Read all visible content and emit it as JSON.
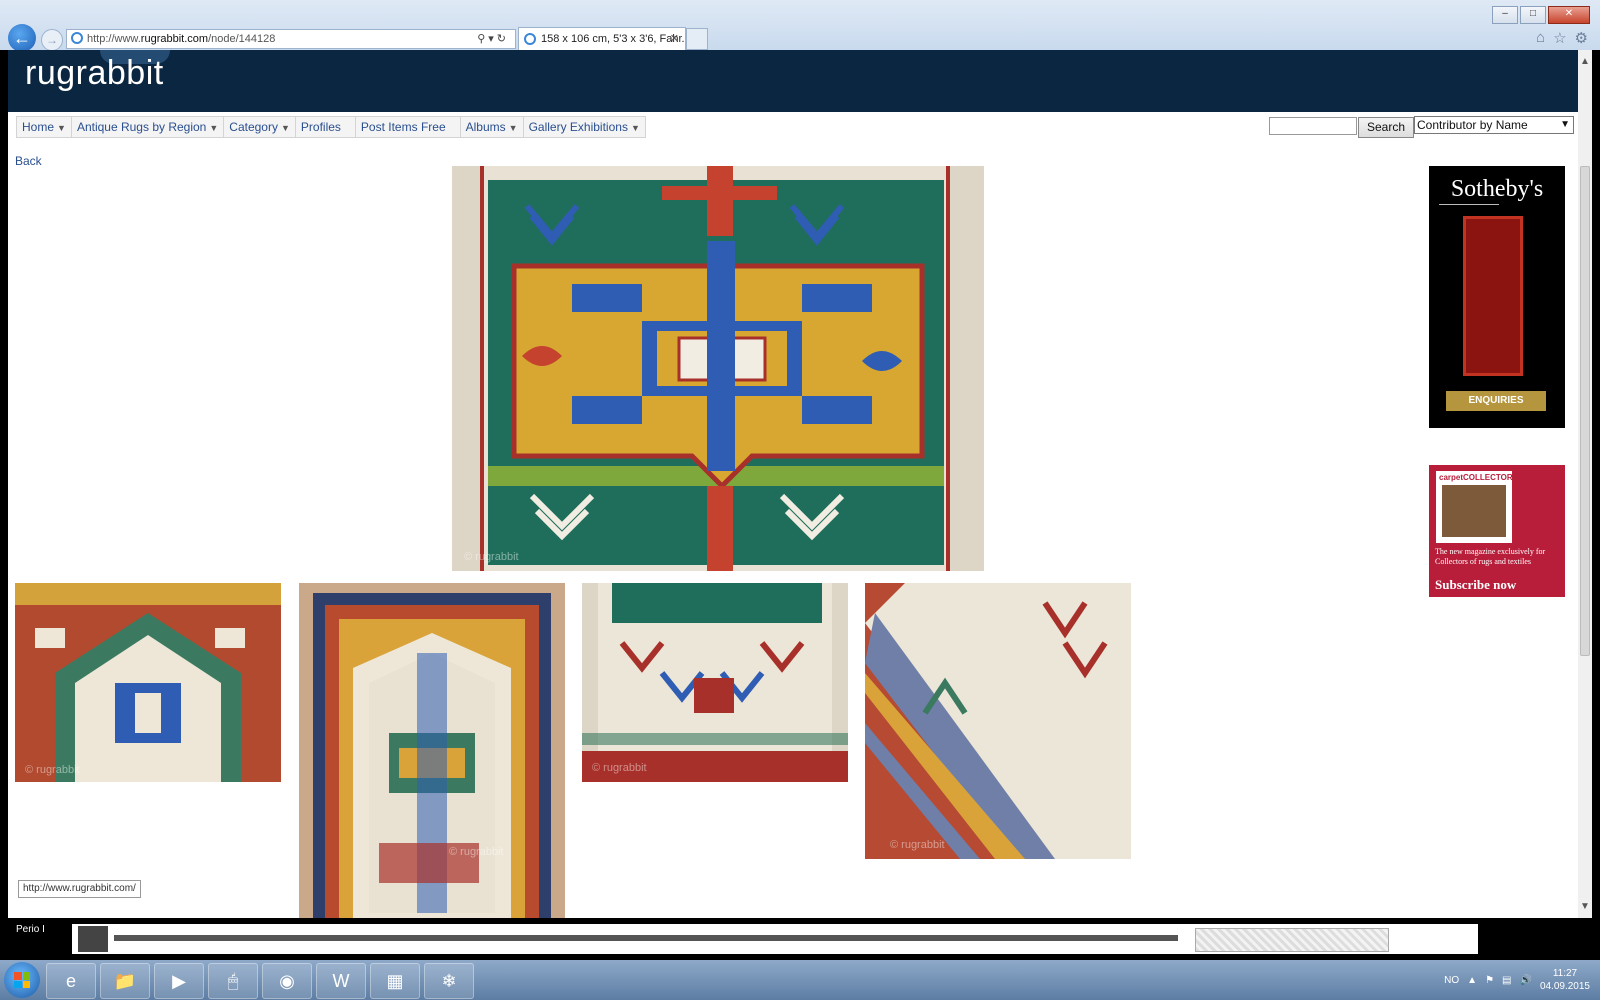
{
  "browser": {
    "url_prefix": "http://www.",
    "url_domain": "rugrabbit.com",
    "url_path": "/node/144128",
    "tab_title": "158 x 106 cm, 5'3 x 3'6, Fahr...",
    "tab_close": "✕",
    "window_minimize": "–",
    "window_maximize": "□",
    "window_close": "✕"
  },
  "site": {
    "logo": "rugrabbit",
    "back_label": "Back",
    "menu": [
      {
        "label": "Home",
        "has_caret": true
      },
      {
        "label": "Antique Rugs by Region",
        "has_caret": true
      },
      {
        "label": "Category",
        "has_caret": true
      },
      {
        "label": "Profiles",
        "has_caret": false
      },
      {
        "label": "Post Items Free",
        "has_caret": false
      },
      {
        "label": "Albums",
        "has_caret": true
      },
      {
        "label": "Gallery Exhibitions",
        "has_caret": true
      }
    ],
    "caret": "▼",
    "search_button": "Search",
    "search_value": "",
    "contributor_select": "Contributor by Name",
    "watermark": "© rugrabbit"
  },
  "ads": {
    "sothebys_brand": "Sotheby's",
    "sothebys_button": "ENQUIRIES",
    "carpet_mag_title": "carpetCOLLECTOR",
    "carpet_tagline": "The new magazine exclusively for Collectors of rugs and textiles",
    "carpet_cta": "Subscribe now"
  },
  "status_bar_url": "http://www.rugrabbit.com/",
  "background_app": {
    "label": "Perio I"
  },
  "taskbar": {
    "lang": "NO",
    "time": "11:27",
    "date": "04.09.2015"
  }
}
